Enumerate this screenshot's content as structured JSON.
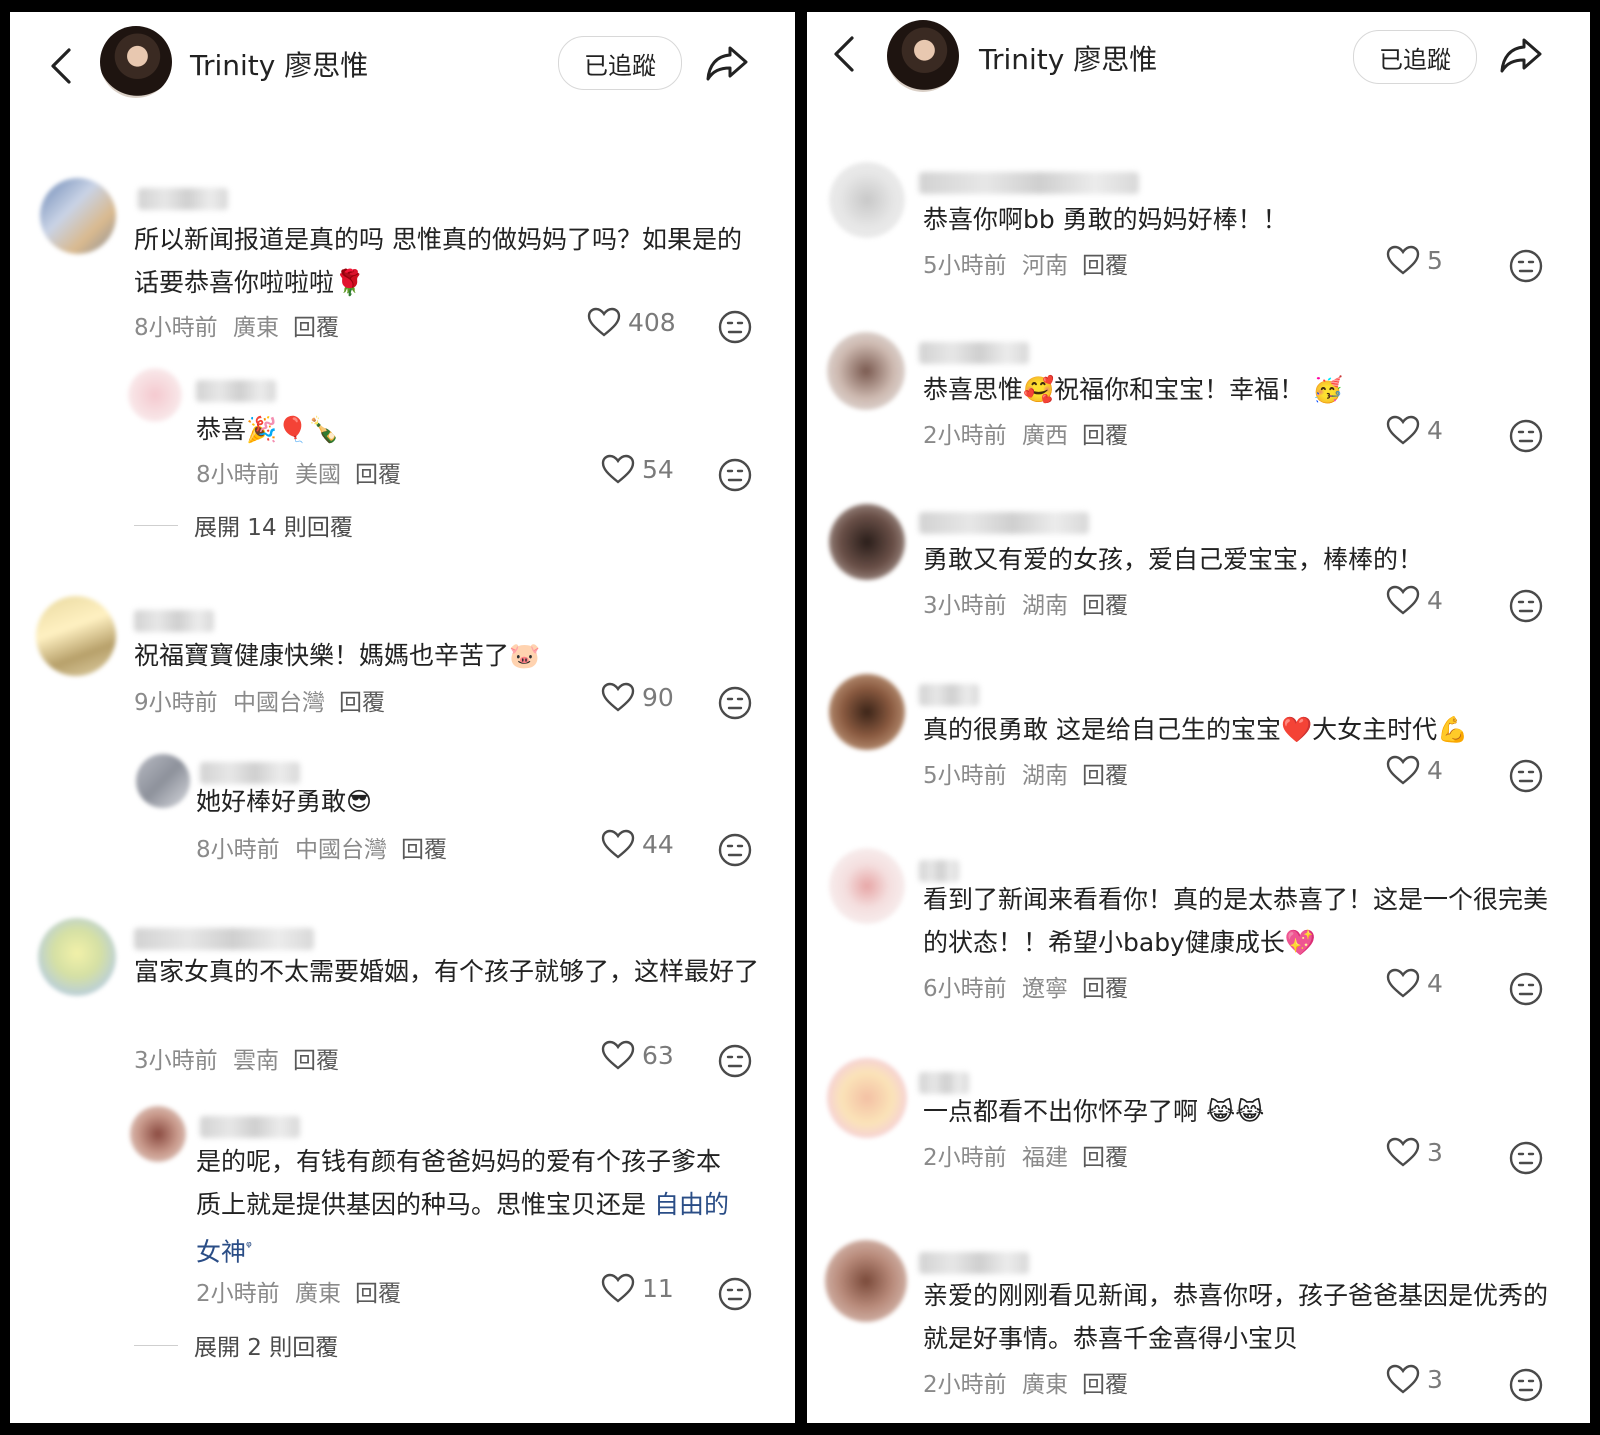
{
  "colors": {
    "link": "#2a4d86",
    "meta": "#8a8a8a"
  },
  "header": {
    "username": "Trinity 廖思惟",
    "follow_label": "已追蹤",
    "icons": [
      "back-arrow-icon",
      "share-icon"
    ]
  },
  "left": {
    "comments": [
      {
        "text": "所以新闻报道是真的吗 思惟真的做妈妈了吗？如果是的话要恭喜你啦啦啦🌹",
        "time": "8小時前",
        "location": "廣東",
        "reply": "回覆",
        "likes": "408"
      },
      {
        "text": "恭喜🎉🎈🍾",
        "time": "8小時前",
        "location": "美國",
        "reply": "回覆",
        "likes": "54"
      },
      {
        "text": "祝福寶寶健康快樂！媽媽也辛苦了🐷",
        "time": "9小時前",
        "location": "中國台灣",
        "reply": "回覆",
        "likes": "90"
      },
      {
        "text": "她好棒好勇敢😎",
        "time": "8小時前",
        "location": "中國台灣",
        "reply": "回覆",
        "likes": "44"
      },
      {
        "text": "富家女真的不太需要婚姻，有个孩子就够了，这样最好了",
        "time": "3小時前",
        "location": "雲南",
        "reply": "回覆",
        "likes": "63"
      },
      {
        "text": "是的呢，有钱有颜有爸爸妈妈的爱有个孩子爹本质上就是提供基因的种马。思惟宝贝还是",
        "link_text": "自由的女神",
        "link_icon": "ᵠ",
        "time": "2小時前",
        "location": "廣東",
        "reply": "回覆",
        "likes": "11"
      }
    ],
    "expand_1": "展開 14 則回覆",
    "expand_2": "展開 2 則回覆"
  },
  "right": {
    "comments": [
      {
        "text": "恭喜你啊bb 勇敢的妈妈好棒！！",
        "time": "5小時前",
        "location": "河南",
        "reply": "回覆",
        "likes": "5"
      },
      {
        "text": "恭喜思惟🥰祝福你和宝宝！幸福！ 🥳",
        "time": "2小時前",
        "location": "廣西",
        "reply": "回覆",
        "likes": "4"
      },
      {
        "text": "勇敢又有爱的女孩，爱自己爱宝宝，棒棒的！",
        "time": "3小時前",
        "location": "湖南",
        "reply": "回覆",
        "likes": "4"
      },
      {
        "text": "真的很勇敢 这是给自己生的宝宝❤️大女主时代💪",
        "time": "5小時前",
        "location": "湖南",
        "reply": "回覆",
        "likes": "4"
      },
      {
        "text": "看到了新闻来看看你！真的是太恭喜了！这是一个很完美的状态！！希望小baby健康成长💖",
        "time": "6小時前",
        "location": "遼寧",
        "reply": "回覆",
        "likes": "4"
      },
      {
        "text": "一点都看不出你怀孕了啊 😹😹",
        "time": "2小時前",
        "location": "福建",
        "reply": "回覆",
        "likes": "3"
      },
      {
        "text": "亲爱的刚刚看见新闻，恭喜你呀，孩子爸爸基因是优秀的就是好事情。恭喜千金喜得小宝贝",
        "time": "2小時前",
        "location": "廣東",
        "reply": "回覆",
        "likes": "3"
      }
    ]
  }
}
